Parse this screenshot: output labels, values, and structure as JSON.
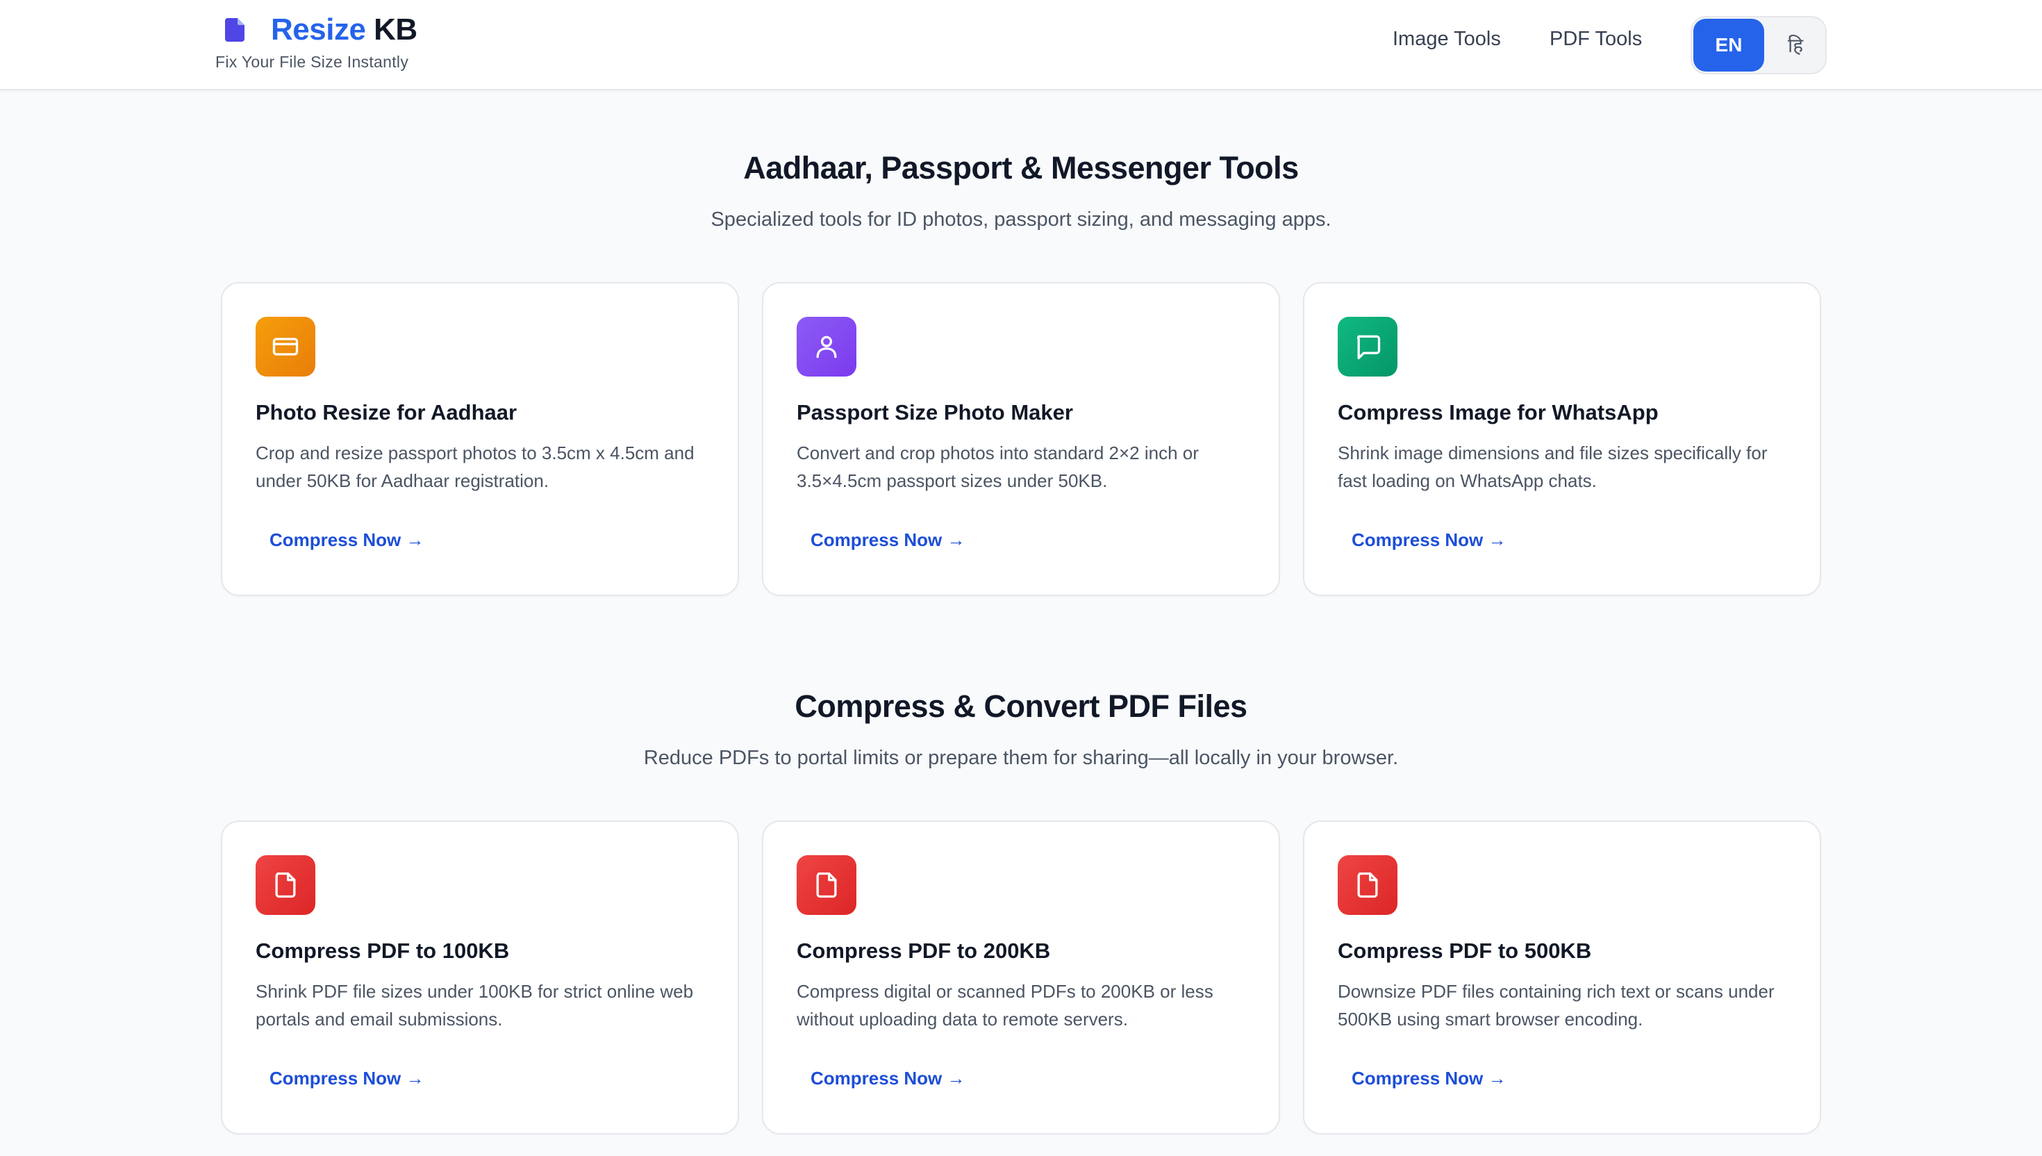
{
  "header": {
    "brand_part1": "Resize",
    "brand_part2": "KB",
    "tagline": "Fix Your File Size Instantly",
    "nav": [
      "Image Tools",
      "PDF Tools"
    ],
    "lang_active": "EN",
    "lang_other": "हि"
  },
  "section1": {
    "title": "Aadhaar, Passport & Messenger Tools",
    "subtitle": "Specialized tools for ID photos, passport sizing, and messaging apps.",
    "cards": [
      {
        "icon": "id-card-icon",
        "title": "Photo Resize for Aadhaar",
        "desc": "Crop and resize passport photos to 3.5cm x 4.5cm and under 50KB for Aadhaar registration.",
        "link": "Compress Now →"
      },
      {
        "icon": "user-icon",
        "title": "Passport Size Photo Maker",
        "desc": "Convert and crop photos into standard 2×2 inch or 3.5×4.5cm passport sizes under 50KB.",
        "link": "Compress Now →"
      },
      {
        "icon": "chat-icon",
        "title": "Compress Image for WhatsApp",
        "desc": "Shrink image dimensions and file sizes specifically for fast loading on WhatsApp chats.",
        "link": "Compress Now →"
      }
    ]
  },
  "section2": {
    "title": "Compress & Convert PDF Files",
    "subtitle": "Reduce PDFs to portal limits or prepare them for sharing—all locally in your browser.",
    "cards": [
      {
        "icon": "file-icon",
        "title": "Compress PDF to 100KB",
        "desc": "Shrink PDF file sizes under 100KB for strict online web portals and email submissions.",
        "link": "Compress Now →"
      },
      {
        "icon": "file-icon",
        "title": "Compress PDF to 200KB",
        "desc": "Compress digital or scanned PDFs to 200KB or less without uploading data to remote servers.",
        "link": "Compress Now →"
      },
      {
        "icon": "file-icon",
        "title": "Compress PDF to 500KB",
        "desc": "Downsize PDF files containing rich text or scans under 500KB using smart browser encoding.",
        "link": "Compress Now →"
      }
    ]
  },
  "colors": {
    "primary": "#2563eb",
    "aadhaar_icon": "#f59e0b",
    "passport_icon": "#8b5cf6",
    "whatsapp_icon": "#10b981",
    "pdf_icon": "#ef4444"
  }
}
